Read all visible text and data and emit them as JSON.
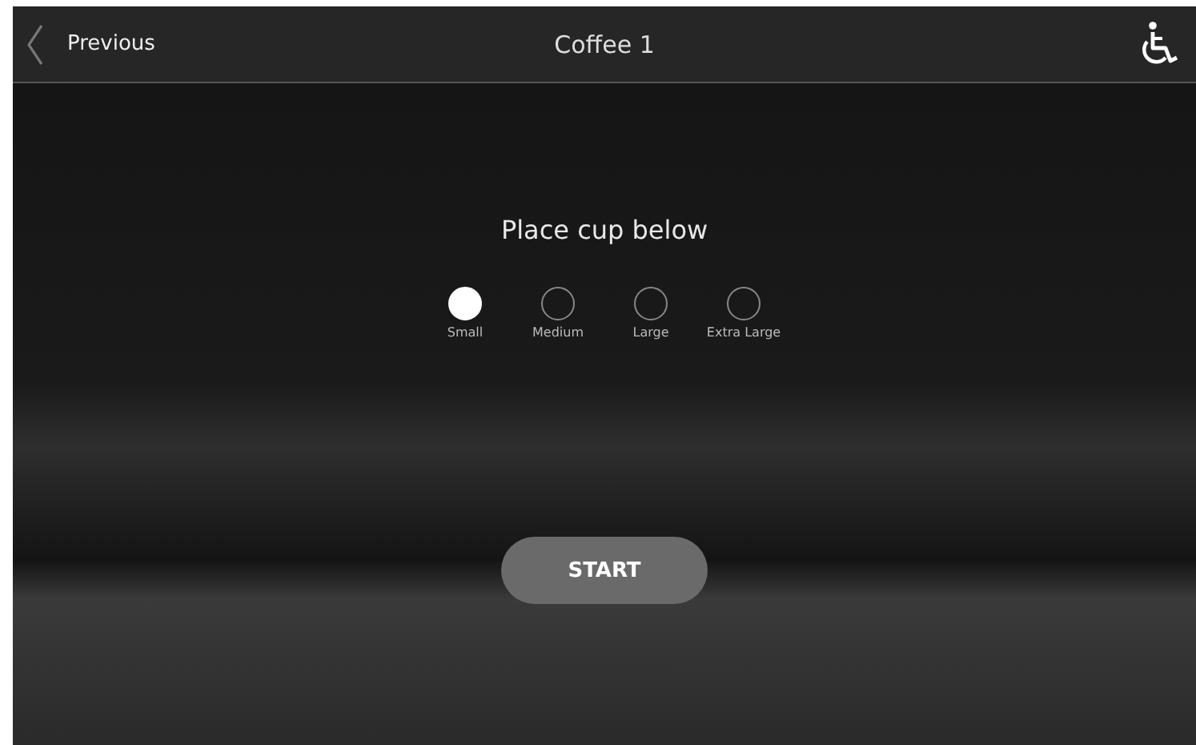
{
  "header": {
    "back_label": "Previous",
    "title": "Coffee 1"
  },
  "prompt": "Place cup below",
  "sizes": [
    {
      "label": "Small",
      "selected": true
    },
    {
      "label": "Medium",
      "selected": false
    },
    {
      "label": "Large",
      "selected": false
    },
    {
      "label": "Extra Large",
      "selected": false
    }
  ],
  "start_button": "START"
}
